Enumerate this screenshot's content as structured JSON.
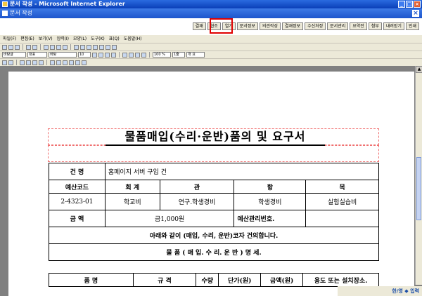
{
  "window": {
    "title": "문서 작성 - Microsoft Internet Explorer",
    "subtitle": "문서 작성"
  },
  "top_buttons": [
    "결재",
    "협조",
    "열기",
    "문서정보",
    "의견작성",
    "결재정보",
    "수신처정",
    "문서관리",
    "요약전",
    "첨부",
    "내려받기",
    "인쇄"
  ],
  "menu": [
    "파일(F)",
    "편집(E)",
    "보기(V)",
    "입력(I)",
    "모양(L)",
    "도구(K)",
    "표(Q)",
    "도움말(H)"
  ],
  "toolbar": {
    "style_select": "바탕글",
    "font_type_select": "대표",
    "font_select": "바탕",
    "size_select": "10",
    "zoom_select": "100 %",
    "line_spacing": "1줄",
    "para_select": "개 요"
  },
  "document": {
    "title": "물품매입(수리·운반)품의 및 요구서",
    "row_subject": {
      "label": "건    명",
      "value": "홈페이지 서버 구입 건"
    },
    "budget_header": {
      "code": "예산코드",
      "type": "회 계",
      "gwan": "관",
      "hang": "항",
      "mok": "목"
    },
    "budget_values": {
      "code": "2-4323-01",
      "type": "학교비",
      "gwan": "연구.학생경비",
      "hang": "학생경비",
      "mok": "실험실습비"
    },
    "amount": {
      "label": "금    액",
      "value": "금1,000원",
      "mgmt_label": "예산관리번호."
    },
    "request_text": "아래와 같이 (매입, 수리, 운반)코자 건의합니다.",
    "spec_title": "물    품 ( 매 입. 수 리. 운 반 ) 명    세.",
    "spec_headers": {
      "item": "품    명",
      "spec": "규    격",
      "qty": "수량",
      "unit_price": "단가(원)",
      "amount": "금액(원)",
      "usage": "용도 또는 설치장소."
    }
  },
  "status": {
    "ime": "한/영 ◆ 입력"
  }
}
